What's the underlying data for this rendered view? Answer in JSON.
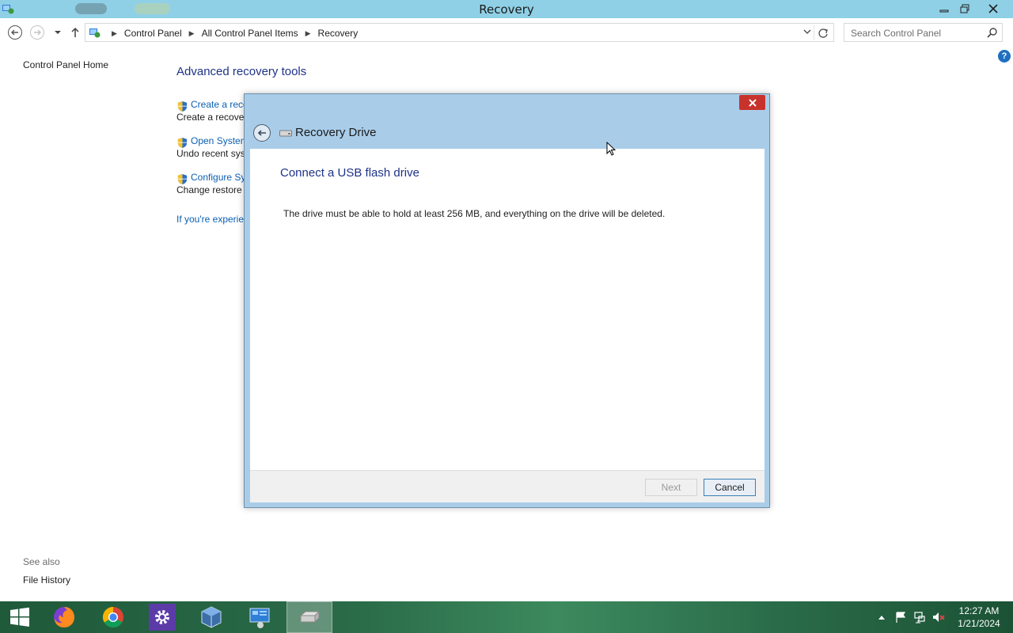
{
  "window": {
    "title": "Recovery"
  },
  "address": {
    "crumbs": [
      "Control Panel",
      "All Control Panel Items",
      "Recovery"
    ]
  },
  "search": {
    "placeholder": "Search Control Panel"
  },
  "sidebar": {
    "home": "Control Panel Home",
    "see_also": "See also",
    "file_history": "File History"
  },
  "main": {
    "heading": "Advanced recovery tools",
    "tools": [
      {
        "link": "Create a reco",
        "desc": "Create a recover"
      },
      {
        "link": "Open System",
        "desc": "Undo recent sys"
      },
      {
        "link": "Configure Sy",
        "desc": "Change restore s"
      }
    ],
    "trouble_link": "If you're experien"
  },
  "dialog": {
    "title": "Recovery Drive",
    "instruction": "Connect a USB flash drive",
    "message": "The drive must be able to hold at least 256 MB, and everything on the drive will be deleted.",
    "next_label": "Next",
    "cancel_label": "Cancel"
  },
  "taskbar": {
    "time": "12:27 AM",
    "date": "1/21/2024"
  },
  "colors": {
    "titlebar": "#8fd0e6",
    "link": "#0b5fb3",
    "heading": "#1e3287",
    "close_button": "#c7332c"
  }
}
